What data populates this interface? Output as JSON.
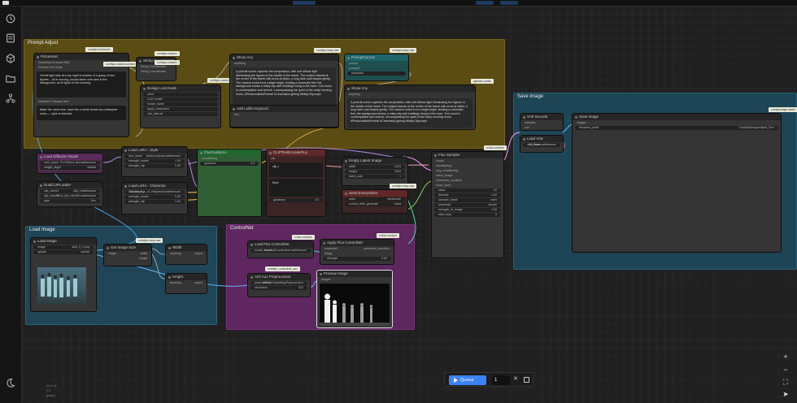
{
  "app": {
    "version_lines": [
      "v1.0.0a",
      "1.2",
      "(main)"
    ]
  },
  "groups": {
    "prompt_adjust": "Prompt Adjust",
    "load_image": "Load Image",
    "controlnet": "ControlNet",
    "save_image": "Save Image"
  },
  "nodes": {
    "pictureset": {
      "title": "PictureSet",
      "row1": "Download AI model files",
      "row2": "Preview Text Node",
      "text1": "Gentle light falls at a city night in shades of a group of four figures... All is moving, photos taken with care in the background, as lit lights on the evening.",
      "row3": "Describe Changes here",
      "text2": "Make the robot blue, have him a smile shown by christopher nolan — style is futuristic"
    },
    "string_concat": {
      "title": "String Concatenate",
      "row1": "String Concatenate",
      "row2": "String Concatenate"
    },
    "design_lora": {
      "title": "Design LLM Node",
      "w1": "seed",
      "w2": "LLM_model",
      "w3": "model_name",
      "w4": "apply_instruction",
      "w5": "use_instruct"
    },
    "show_any1": {
      "title": "Show Any",
      "label": "anything",
      "out": "output"
    },
    "prompt_concat": {
      "title": "PromptConcat",
      "r1": "prompt",
      "r2": "prompt2",
      "w": "separator"
    },
    "show_any2": {
      "title": "Show Any",
      "label": "anything",
      "text": "A portrait scene captures the composition, with soft diffuse light illuminating the figures in the middle of the frame. The subject stands at the center of the frame with arms at sides; a long dark coat drapes gently. The camera looks from a slight angle, lending a cinematic feel; the background shows a misty city with buildings rising in the haze. The mood is contemplative and serene, encompassing the quiet of the early morning hours. #PhotorealisticPortrait #CinematicLighting #MistyCityscape"
    },
    "anyfile": {
      "title": "Add Lofile Keyword",
      "text": "text"
    },
    "load_diffusion": {
      "title": "Load Diffusion Model",
      "w1": "unet_name",
      "w1v": "FLUX/flux1-dev.safetensors",
      "w2": "weight_dtype",
      "w2v": "default"
    },
    "dual_clip": {
      "title": "DualCLIPLoader",
      "w1": "clip_name1",
      "w1v": "clip_l.safetensors",
      "w2": "clip_name2",
      "w2v": "t5xxl_fp8_e4m3fn.safetensors",
      "w3": "type",
      "w3v": "flux"
    },
    "lora_style": {
      "title": "Load LoRA - Style",
      "w1": "lora_name",
      "w1v": "photo-realistic.safetensors",
      "w2": "strength_model",
      "w2v": "1.00",
      "w3": "strength_clip",
      "w3v": "1.00"
    },
    "lora_char": {
      "title": "Load LoRA - Character",
      "w1": "lora_name",
      "w1v": "Golden_Age_of_Hollywood.safetensors",
      "w2": "strength_model",
      "w2v": "0.80",
      "w3": "strength_clip",
      "w3v": "1.00"
    },
    "flux_guidance": {
      "title": "FluxGuidance",
      "r1": "conditioning",
      "w": "guidance",
      "wv": "3.5"
    },
    "clip_pos": {
      "title": "CLIPTextEncodeFlux",
      "r1": "clip",
      "r2": "clip_l",
      "r3": "t5xxl",
      "w": "guidance",
      "wv": "3.5"
    },
    "empty_latent": {
      "title": "Empty Latent Image",
      "w1": "width",
      "w1v": "1024",
      "w2": "height",
      "w2v": "1024",
      "w3": "batch_size",
      "w3v": "1"
    },
    "seed_everywhere": {
      "title": "Seed Everywhere",
      "w1": "seed",
      "w1v": "randomize",
      "w2": "control_after_generate",
      "w2v": "fixed"
    },
    "ksampler": {
      "title": "Flux Sampler",
      "r1": "model",
      "r2": "conditioning",
      "r3": "neg_conditioning",
      "r4": "latent_image",
      "r5": "controlnet_condition",
      "r6": "noise_seed",
      "w1": "steps",
      "w1v": "20",
      "w2": "denoise",
      "w2v": "1.00",
      "w3": "sampler_name",
      "w3v": "euler",
      "w4": "scheduler",
      "w4v": "simple",
      "w5": "strength_to_image",
      "w5v": "1.00",
      "w6": "start_step",
      "w6v": "0"
    },
    "vae_decode": {
      "title": "VAE Decode",
      "r1": "samples",
      "r2": "vae"
    },
    "load_vae": {
      "title": "Load VAE",
      "w": "vae_name",
      "wv": "FLUX/ae.safetensors"
    },
    "save_image": {
      "title": "Save Image",
      "r": "images",
      "w": "filename_prefix",
      "wv": "ComfyUI/ImageAdjust_Flux"
    },
    "load_image": {
      "title": "Load Image",
      "w1": "image",
      "w1v": "shot_3_1.png",
      "w2": "upload",
      "w2v": "upload"
    },
    "get_image_size": {
      "title": "Get Image Size",
      "r": "image",
      "o1": "width",
      "o2": "height",
      "o3": "count"
    },
    "width": {
      "title": "Width",
      "r": "anything",
      "out": "output"
    },
    "height": {
      "title": "Height",
      "r": "anything",
      "out": "output"
    },
    "load_flux_cn": {
      "title": "Load Flux ControlNet",
      "w1": "model_name",
      "w1v": "flux-depth-controlnet.safetensors"
    },
    "apply_flux_cn": {
      "title": "Apply Flux ControlNet",
      "r1": "controlnet",
      "r2": "image",
      "r3": "controlnet_condition",
      "w": "strength",
      "wv": "0.50"
    },
    "aio_aux": {
      "title": "AIO Aux Preprocessor",
      "r": "image",
      "w1": "preprocessor",
      "w1v": "MiDaS-DepthMapPreprocessor",
      "w2": "resolution",
      "w2v": "512"
    },
    "preview_image": {
      "title": "Preview Image",
      "r": "images"
    }
  },
  "tags": {
    "t1": "comfyui-florence2",
    "t2": "comfyui-custom-scripts",
    "t3": "comfyui-custom",
    "t4": "comfyui-custom",
    "t5": "comfyui-custom",
    "t6": "comfyui-easy-use",
    "t7": "comfyui-easy-use",
    "t8": "rgthree-comfy",
    "t9": "x-flux-comfyui",
    "t10": "comfyui-easy-use",
    "t11": "x-flux-comfyui",
    "t12": "comfyui-easy-use",
    "t13": "comfyui_controlnet_aux",
    "t14": "x-flux-comfyui",
    "t15": "comfy-image-saver"
  },
  "queue": {
    "label": "Queue",
    "count": "1"
  },
  "colors": {
    "accent": "#3b82f6",
    "prompt_group": "#6b5a16",
    "load_group": "#1f4759",
    "controlnet_group": "#6a2a6a",
    "save_group": "#1e4656"
  }
}
